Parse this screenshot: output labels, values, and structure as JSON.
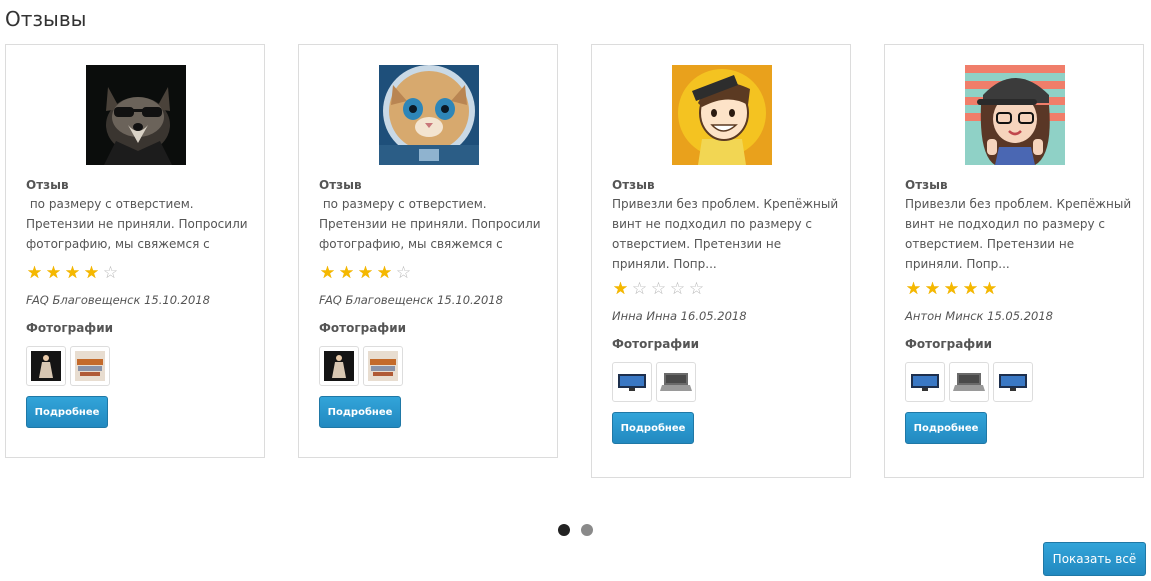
{
  "section_title": "Отзывы",
  "reviews": [
    {
      "avatar": "raccoon-avatar",
      "review_label": "Отзыв",
      "text": " по размеру с отверстием. Претензии не приняли. Попросили фотографию, мы свяжемся с поставщиками, дн...",
      "rating": 4,
      "rating_max": 5,
      "author": "FAQ Благовещенск 15.10.2018",
      "photos_label": "Фотографии",
      "photos": [
        "figure-photo",
        "parts-photo"
      ],
      "more_label": "Подробнее"
    },
    {
      "avatar": "cat-astronaut-avatar",
      "review_label": "Отзыв",
      "text": " по размеру с отверстием. Претензии не приняли. Попросили фотографию, мы свяжемся с поставщиками, дн...",
      "rating": 4,
      "rating_max": 5,
      "author": "FAQ Благовещенск 15.10.2018",
      "photos_label": "Фотографии",
      "photos": [
        "figure-photo",
        "parts-photo"
      ],
      "more_label": "Подробнее"
    },
    {
      "avatar": "cartoon-boy-avatar",
      "review_label": "Отзыв",
      "text": "Привезли без проблем. Крепёжный винт не подходил по размеру с отверстием. Претензии не приняли. Попр...",
      "rating": 1,
      "rating_max": 5,
      "author": "Инна Инна 16.05.2018",
      "photos_label": "Фотографии",
      "photos": [
        "monitor-photo",
        "laptop-photo"
      ],
      "more_label": "Подробнее"
    },
    {
      "avatar": "cartoon-girl-avatar",
      "review_label": "Отзыв",
      "text": "Привезли без проблем. Крепёжный винт не подходил по размеру с отверстием. Претензии не приняли. Попр...",
      "rating": 5,
      "rating_max": 5,
      "author": "Антон Минск 15.05.2018",
      "photos_label": "Фотографии",
      "photos": [
        "monitor-photo",
        "laptop-photo",
        "monitor-photo"
      ],
      "more_label": "Подробнее"
    }
  ],
  "pagination": {
    "pages": 2,
    "current": 1
  },
  "show_all_label": "Показать всё",
  "colors": {
    "accent": "#2b95cf",
    "star_on": "#f5b800",
    "star_off": "#b8b8b8",
    "border": "#dcdcdc"
  }
}
